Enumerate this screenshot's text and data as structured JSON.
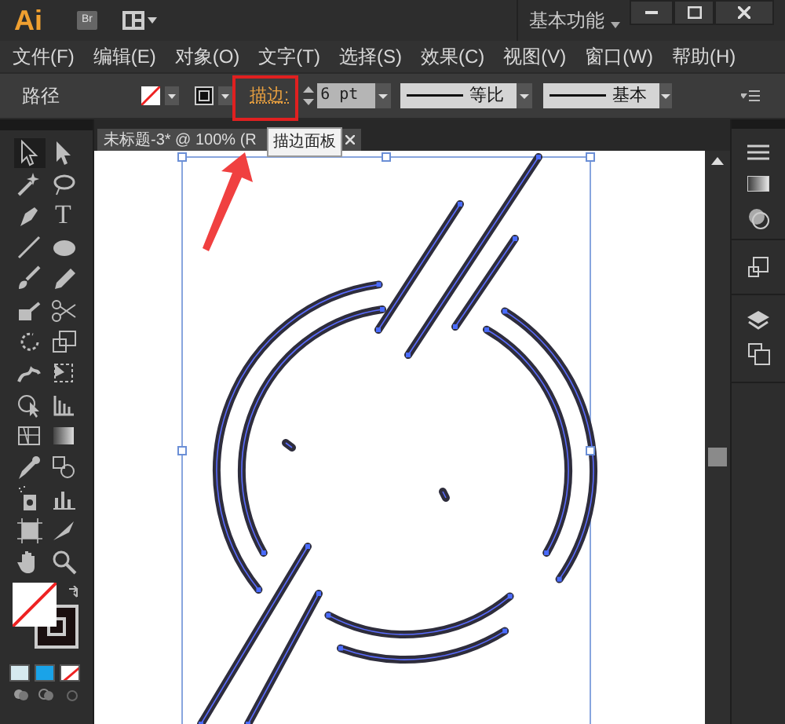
{
  "title_bar": {
    "logo": "Ai",
    "bridge": "Br",
    "workspace": "基本功能"
  },
  "menu": [
    "文件(F)",
    "编辑(E)",
    "对象(O)",
    "文字(T)",
    "选择(S)",
    "效果(C)",
    "视图(V)",
    "窗口(W)",
    "帮助(H)"
  ],
  "control_bar": {
    "selection": "路径",
    "stroke_label": "描边:",
    "stroke_weight": "6 pt",
    "profile": "等比",
    "brush": "基本"
  },
  "document_tab": {
    "title": "未标题-3* @ 100% (R"
  },
  "tooltip": "描边面板",
  "type_tool": "T"
}
